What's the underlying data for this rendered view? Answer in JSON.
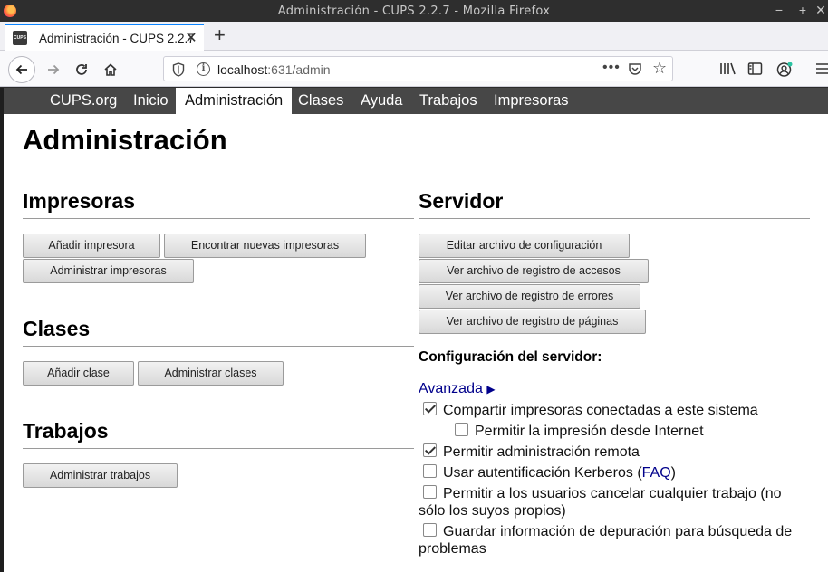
{
  "window": {
    "title": "Administración - CUPS 2.2.7 - Mozilla Firefox",
    "controls": [
      "−",
      "+",
      "✕"
    ]
  },
  "tab": {
    "favicon_text": "CUPS",
    "title": "Administración - CUPS 2.2.7",
    "close": "✕",
    "new_tab": "+"
  },
  "navbar": {
    "url_host": "localhost",
    "url_rest": ":631/admin",
    "more": "•••"
  },
  "cups_nav": {
    "items": [
      "CUPS.org",
      "Inicio",
      "Administración",
      "Clases",
      "Ayuda",
      "Trabajos",
      "Impresoras"
    ]
  },
  "page": {
    "title": "Administración",
    "printers": {
      "heading": "Impresoras",
      "add": "Añadir impresora",
      "find": "Encontrar nuevas impresoras",
      "manage": "Administrar impresoras"
    },
    "classes": {
      "heading": "Clases",
      "add": "Añadir clase",
      "manage": "Administrar clases"
    },
    "jobs": {
      "heading": "Trabajos",
      "manage": "Administrar trabajos"
    },
    "server": {
      "heading": "Servidor",
      "edit_config": "Editar archivo de configuración",
      "access_log": "Ver archivo de registro de accesos",
      "error_log": "Ver archivo de registro de errores",
      "page_log": "Ver archivo de registro de páginas",
      "config_title": "Configuración del servidor:",
      "advanced": "Avanzada",
      "advanced_arrow": "▶",
      "options": {
        "share": {
          "label": "Compartir impresoras conectadas a este sistema",
          "checked": true
        },
        "internet": {
          "label": "Permitir la impresión desde Internet",
          "checked": false
        },
        "remote_admin": {
          "label": "Permitir administración remota",
          "checked": true
        },
        "kerberos": {
          "label_before": "Usar autentificación Kerberos (",
          "link": "FAQ",
          "label_after": ")",
          "checked": false
        },
        "cancel_any": {
          "label": "Permitir a los usuarios cancelar cualquier trabajo (no sólo los suyos propios)",
          "checked": false
        },
        "debug": {
          "label": "Guardar información de depuración para búsqueda de problemas",
          "checked": false
        }
      }
    }
  },
  "colors": {
    "cups_nav_bg": "#474747",
    "link": "#00008b",
    "tab_accent": "#0a84ff"
  }
}
